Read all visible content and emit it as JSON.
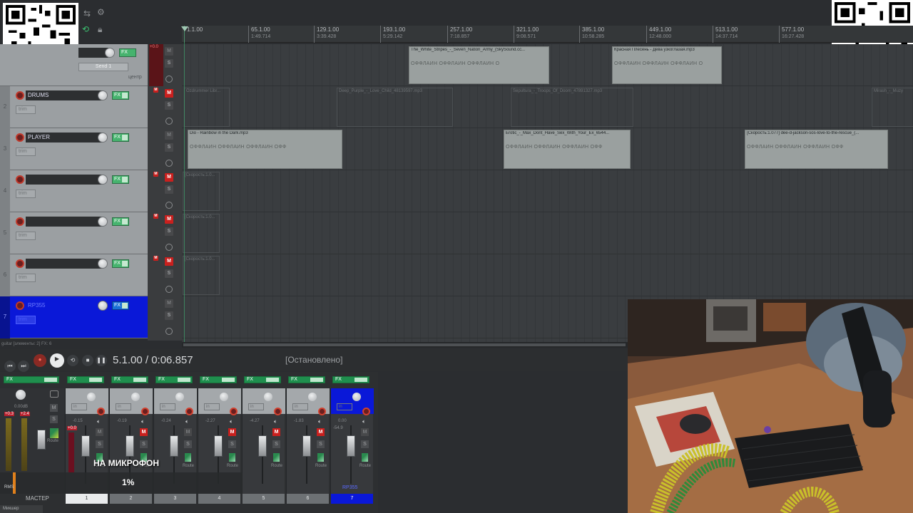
{
  "ruler": {
    "ticks": [
      {
        "bar": "1.1.00",
        "time": ""
      },
      {
        "bar": "65.1.00",
        "time": "1:49.714"
      },
      {
        "bar": "129.1.00",
        "time": "3:39.428"
      },
      {
        "bar": "193.1.00",
        "time": "5:29.142"
      },
      {
        "bar": "257.1.00",
        "time": "7:18.857"
      },
      {
        "bar": "321.1.00",
        "time": "9:08.571"
      },
      {
        "bar": "385.1.00",
        "time": "10:58.285"
      },
      {
        "bar": "449.1.00",
        "time": "12:48.000"
      },
      {
        "bar": "513.1.00",
        "time": "14:37.714"
      },
      {
        "bar": "577.1.00",
        "time": "16:27.428"
      }
    ]
  },
  "tracks": [
    {
      "num": "2",
      "name": "DRUMS",
      "trim": "trim",
      "fx": "FX"
    },
    {
      "num": "3",
      "name": "PLAYER",
      "trim": "trim",
      "fx": "FX"
    },
    {
      "num": "4",
      "name": "",
      "trim": "trim",
      "fx": "FX"
    },
    {
      "num": "5",
      "name": "",
      "trim": "trim",
      "fx": "FX"
    },
    {
      "num": "6",
      "name": "",
      "trim": "trim",
      "fx": "FX"
    },
    {
      "num": "7",
      "name": "RP355",
      "trim": "trim",
      "fx": "FX"
    }
  ],
  "master_track": {
    "send": "Send 1",
    "pan": "центр",
    "meter": "+0.0"
  },
  "ms": {
    "m": "M",
    "s": "S"
  },
  "items": {
    "lane1": [
      {
        "title": "The_White_Stripes_-_Seven_Nation_Army_(SkySound.cc...",
        "wave": "ОФФЛАЙН ОФФЛАЙН ОФФЛАЙН О"
      },
      {
        "title": "Красная Плесень - Дева узкоглазая.mp3",
        "wave": "ОФФЛАЙН ОФФЛАЙН ОФФЛАЙН О"
      }
    ],
    "lane2": [
      {
        "title": "Ozdrummer Libr..."
      },
      {
        "title": "Deep_Purple_-_Love_Child_48139597.mp3"
      },
      {
        "title": "Sepultura_-_Troops_Of_Doom_47891327.mp3"
      },
      {
        "title": "Mirash_-_Muzy"
      }
    ],
    "lane3": [
      {
        "title": "Dio - Rainbow in the Dark.mp3",
        "wave": "ОФФЛАЙН ОФФЛАЙН ОФФЛАЙН ОФФ"
      },
      {
        "title": "Erotic_-_Max_Dont_Have_Sex_With_Your_Ex_6544...",
        "wave": "ОФФЛАЙН ОФФЛАЙН ОФФЛАЙН ОФФ"
      },
      {
        "title": "[Скорость:1.077] dee-d-jackson-sos-love-to-the-rescue_(...",
        "wave": "ОФФЛАЙН ОФФЛАЙН ОФФЛАЙН ОФФ"
      }
    ],
    "lane4": [
      {
        "title": "[Скорость:1.0..."
      }
    ],
    "lane5": [
      {
        "title": "[Скорость:1.0..."
      }
    ],
    "lane6": [
      {
        "title": "[Скорость:1.0..."
      }
    ]
  },
  "status_line": "guitar [элементы: 2] FX: 6",
  "transport": {
    "time": "5.1.00 / 0:06.857",
    "state": "[Остановлено]"
  },
  "mixer": {
    "master_label": "МАСТЕР",
    "master_vol": "0.00dB",
    "master_peaks": [
      "+0.3",
      "+2.4"
    ],
    "fx": "FX",
    "in": "in",
    "route": "Route",
    "strips": [
      {
        "num": "1",
        "vol": "-0.15",
        "peak": "+0.0"
      },
      {
        "num": "2",
        "vol": "-0.19",
        "peak": ""
      },
      {
        "num": "3",
        "vol": "-0.24",
        "peak": ""
      },
      {
        "num": "4",
        "vol": "-2.27",
        "peak": ""
      },
      {
        "num": "5",
        "vol": "-4.27",
        "peak": ""
      },
      {
        "num": "6",
        "vol": "-1.83",
        "peak": ""
      },
      {
        "num": "7",
        "vol": "0.00",
        "peak": "-54.9",
        "name": "RP355"
      }
    ],
    "scale": [
      "6",
      "0",
      "-6",
      "-12",
      "-18",
      "-24",
      "-30",
      "-42",
      "-54",
      "-inf"
    ],
    "rms": "RMS",
    "tab": "Микшер"
  },
  "overlay": {
    "caption": "НА МИКРОФОН",
    "percent": "1%",
    "progress": 0.01
  },
  "colors": {
    "selected_track": "#0a18d8",
    "mute_on": "#c9201e",
    "fx_green": "#46b36e"
  },
  "icons": [
    "qr-code-icon",
    "record-arm-icon",
    "play-icon",
    "stop-icon",
    "pause-icon",
    "skip-back-icon",
    "skip-forward-icon",
    "speaker-icon",
    "lock-icon",
    "loop-icon"
  ]
}
